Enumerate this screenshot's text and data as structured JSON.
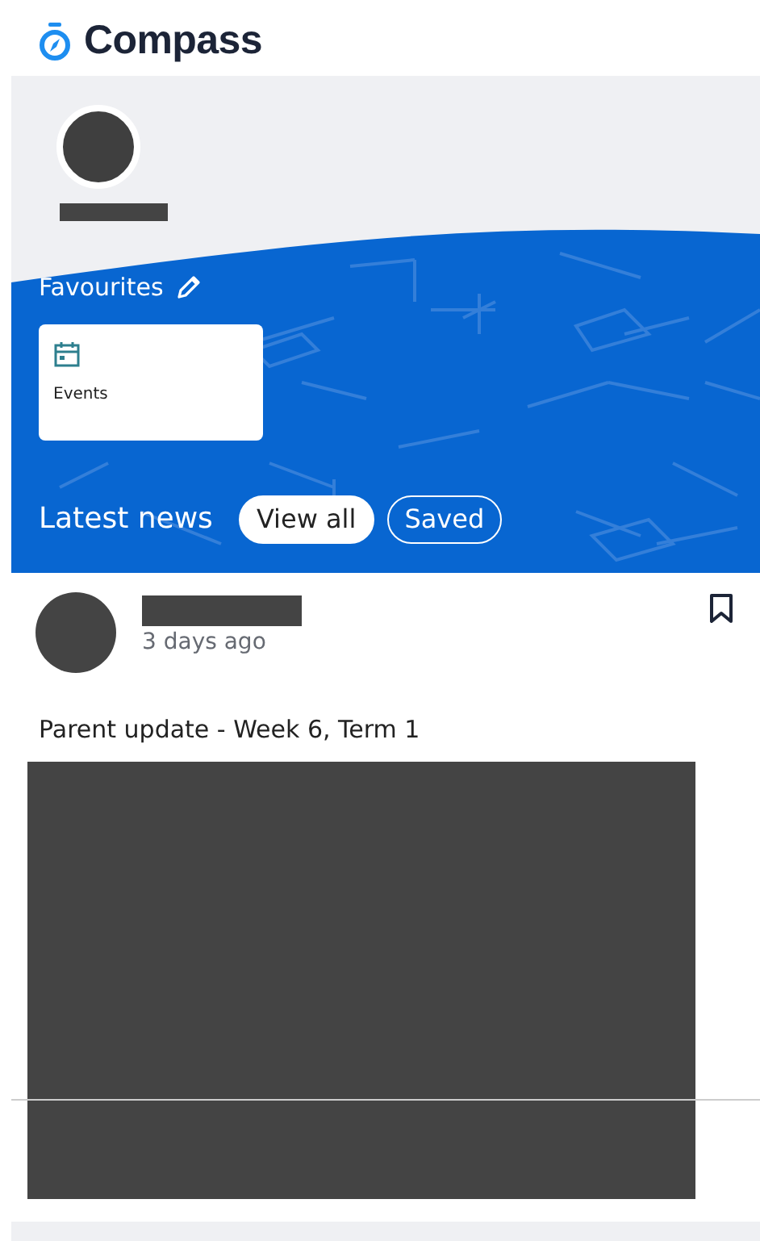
{
  "app": {
    "name": "Compass"
  },
  "favourites": {
    "title": "Favourites",
    "tiles": [
      {
        "label": "Events"
      }
    ]
  },
  "news": {
    "title": "Latest news",
    "filters": [
      {
        "label": "View all",
        "selected": true
      },
      {
        "label": "Saved",
        "selected": false
      }
    ],
    "posts": [
      {
        "time": "3 days ago",
        "title": "Parent update - Week 6, Term 1",
        "bookmarked": false
      }
    ]
  }
}
